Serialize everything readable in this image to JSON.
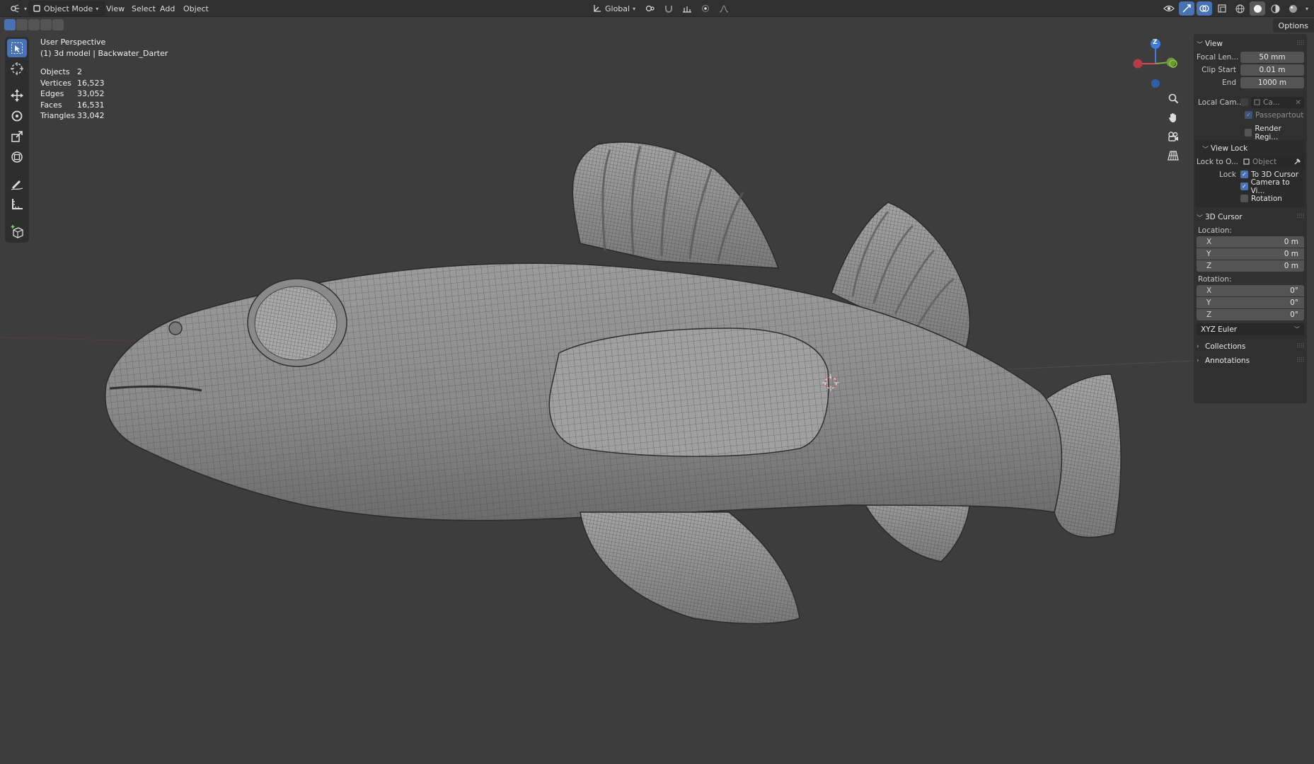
{
  "header": {
    "mode": "Object Mode",
    "menus": [
      "View",
      "Select",
      "Add",
      "Object"
    ],
    "orientation": "Global",
    "options_label": "Options"
  },
  "overlay": {
    "view_name": "User Perspective",
    "scene_info": "(1) 3d model | Backwater_Darter",
    "stats": [
      {
        "label": "Objects",
        "value": "2"
      },
      {
        "label": "Vertices",
        "value": "16,523"
      },
      {
        "label": "Edges",
        "value": "33,052"
      },
      {
        "label": "Faces",
        "value": "16,531"
      },
      {
        "label": "Triangles",
        "value": "33,042"
      }
    ]
  },
  "gizmo": {
    "z_label": "Z"
  },
  "sidebar": {
    "view": {
      "title": "View",
      "focal_length_label": "Focal Len...",
      "focal_length_value": "50 mm",
      "clip_start_label": "Clip Start",
      "clip_start_value": "0.01 m",
      "end_label": "End",
      "end_value": "1000 m",
      "local_camera_label": "Local Cam...",
      "local_camera_value": "Ca...",
      "passepartout_label": "Passepartout",
      "render_region_label": "Render Regi..."
    },
    "view_lock": {
      "title": "View Lock",
      "lock_to_object_label": "Lock to O...",
      "lock_to_object_placeholder": "Object",
      "lock_label": "Lock",
      "to_3d_cursor": "To 3D Cursor",
      "camera_to_view": "Camera to Vi...",
      "rotation": "Rotation"
    },
    "cursor": {
      "title": "3D Cursor",
      "location_label": "Location:",
      "location": [
        {
          "axis": "X",
          "value": "0 m"
        },
        {
          "axis": "Y",
          "value": "0 m"
        },
        {
          "axis": "Z",
          "value": "0 m"
        }
      ],
      "rotation_label": "Rotation:",
      "rotation": [
        {
          "axis": "X",
          "value": "0°"
        },
        {
          "axis": "Y",
          "value": "0°"
        },
        {
          "axis": "Z",
          "value": "0°"
        }
      ],
      "rotation_mode": "XYZ Euler"
    },
    "collections_title": "Collections",
    "annotations_title": "Annotations"
  },
  "colors": {
    "accent": "#4772b3",
    "axis_x": "#e0455a",
    "axis_y": "#7bb33a",
    "axis_z": "#3d7cd9",
    "viewport_bg": "#3d3d3d"
  }
}
